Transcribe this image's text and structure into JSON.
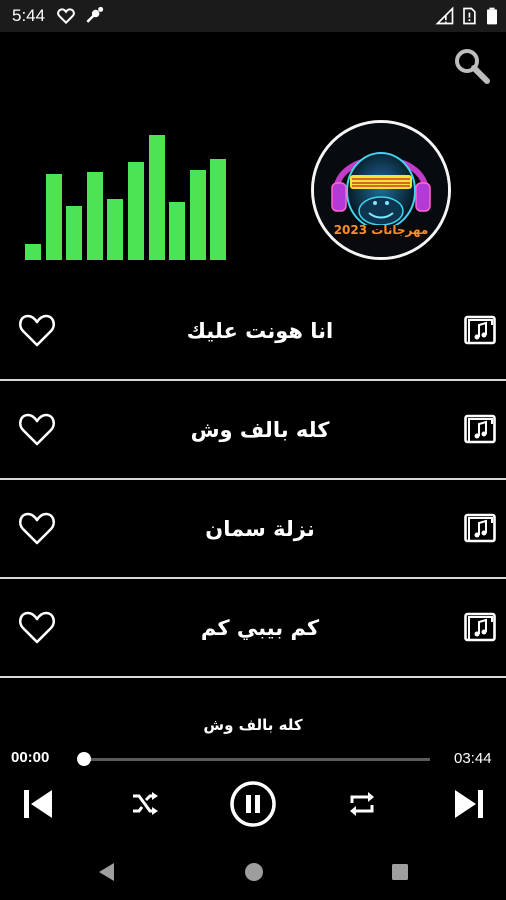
{
  "status_bar": {
    "time": "5:44",
    "icons": [
      "heart-icon",
      "notification-icon",
      "signal-icon",
      "sim-alert-icon",
      "battery-icon"
    ]
  },
  "header": {
    "search_icon": "search-icon"
  },
  "visualizer": {
    "color": "#4ce355",
    "levels": [
      0.1,
      0.54,
      0.34,
      0.55,
      0.38,
      0.61,
      0.78,
      0.36,
      0.56,
      0.63
    ]
  },
  "album": {
    "icon": "gorilla-dj-artwork",
    "logo_text": "مهرجانات 2023"
  },
  "songs": [
    {
      "title": "انا هونت عليك"
    },
    {
      "title": "كله بالف وش"
    },
    {
      "title": "نزلة سمان"
    },
    {
      "title": "كم بيبي كم"
    }
  ],
  "player": {
    "now_playing": "كله بالف وش",
    "current_time": "00:00",
    "total_time": "03:44",
    "progress": 0.0,
    "controls": [
      "skip-previous-icon",
      "shuffle-icon",
      "pause-icon",
      "repeat-icon",
      "skip-next-icon"
    ]
  },
  "nav_bar": {
    "icons": [
      "back-icon",
      "home-icon",
      "recents-icon"
    ]
  },
  "colors": {
    "background": "#000000",
    "accent": "#4ce355",
    "divider": "#d9d9d9"
  }
}
